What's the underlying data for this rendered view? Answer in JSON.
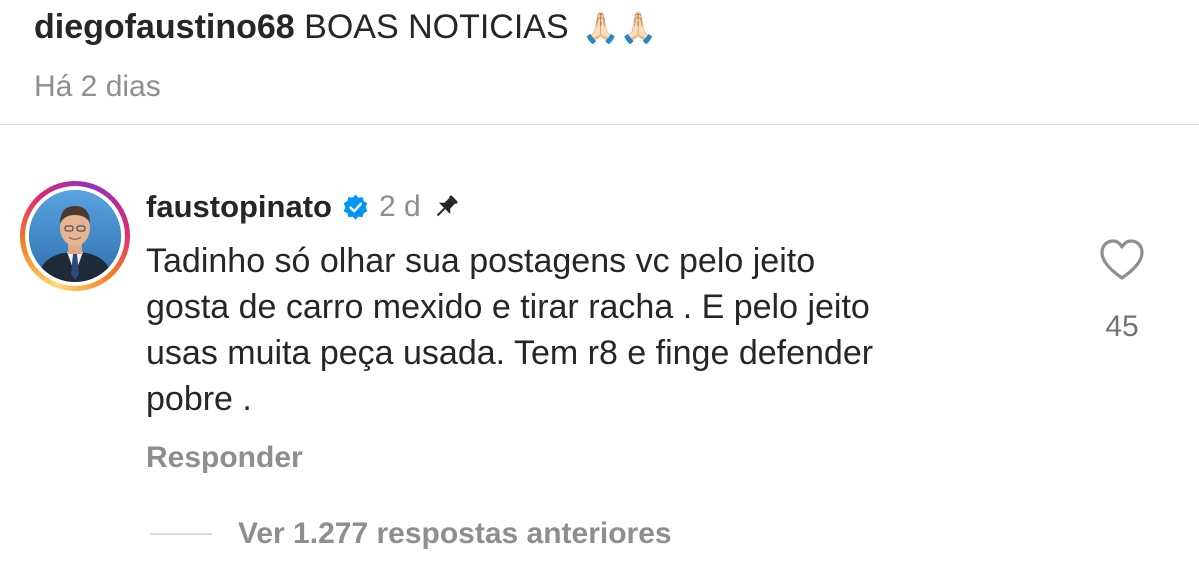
{
  "post": {
    "username": "diegofaustino68",
    "caption": "BOAS NOTICIAS",
    "emojis": "🙏🏻🙏🏻",
    "time": "Há 2 dias"
  },
  "comment": {
    "username": "faustopinato",
    "verified": true,
    "age": "2 d",
    "pinned": true,
    "text": "Tadinho só olhar sua postagens vc pelo jeito\ngosta de carro mexido e tirar racha . E pelo jeito\nusas muita peça usada. Tem r8 e finge defender\npobre .",
    "likes": "45",
    "reply_label": "Responder"
  },
  "replies": {
    "view_label": "Ver 1.277 respostas anteriores"
  },
  "icons": {
    "verified": "verified-badge-icon",
    "pin": "pin-icon",
    "like": "heart-icon"
  },
  "colors": {
    "verified": "#0095f6",
    "secondary_text": "#8e8e8e",
    "primary_text": "#262626"
  }
}
